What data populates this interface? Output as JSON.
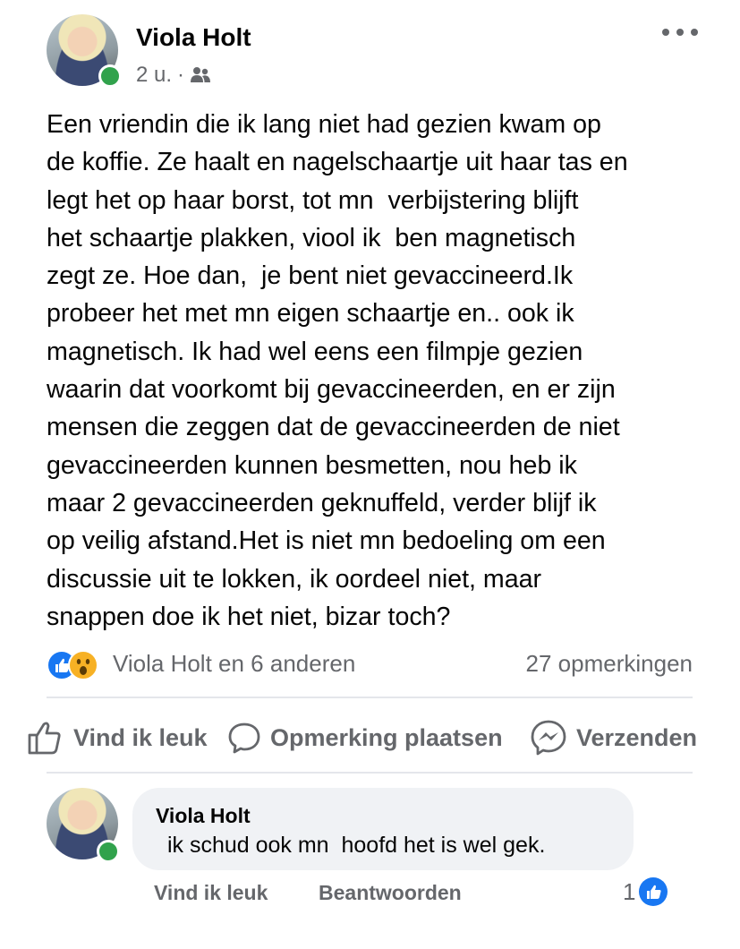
{
  "post": {
    "author": "Viola Holt",
    "time": "2 u.",
    "separator": "·",
    "privacy_icon": "friends-icon",
    "more_icon": "more-horizontal-icon",
    "text_lines": [
      "Een vriendin die ik lang niet had gezien kwam op",
      "de koffie. Ze haalt en nagelschaartje uit haar tas en",
      "legt het op haar borst, tot mn  verbijstering blijft",
      "het schaartje plakken, viool ik  ben magnetisch",
      "zegt ze. Hoe dan,  je bent niet gevaccineerd.Ik",
      "probeer het met mn eigen schaartje en.. ook ik",
      "magnetisch. Ik had wel eens een filmpje gezien",
      "waarin dat voorkomt bij gevaccineerden, en er zijn",
      "mensen die zeggen dat de gevaccineerden de niet",
      "gevaccineerden kunnen besmetten, nou heb ik",
      "maar 2 gevaccineerden geknuffeld, verder blijf ik",
      "op veilig afstand.Het is niet mn bedoeling om een",
      "discussie uit te lokken, ik oordeel niet, maar",
      "snappen doe ik het niet, bizar toch?"
    ],
    "reactions": {
      "icons": [
        "like-reaction-icon",
        "wow-reaction-icon"
      ],
      "reactors": "Viola Holt en 6 anderen",
      "comments": "27 opmerkingen"
    }
  },
  "actions": {
    "like": "Vind ik leuk",
    "comment": "Opmerking plaatsen",
    "send": "Verzenden"
  },
  "comment": {
    "author": "Viola Holt",
    "text": " ik schud ook mn  hoofd het is wel gek.",
    "like_label": "Vind ik leuk",
    "reply_label": "Beantwoorden",
    "like_count": "1"
  },
  "colors": {
    "text": "#050505",
    "secondary": "#65676b",
    "facebook_blue": "#1877f2",
    "online_green": "#31a24c",
    "comment_bg": "#f0f2f5",
    "divider": "#e4e6eb"
  }
}
